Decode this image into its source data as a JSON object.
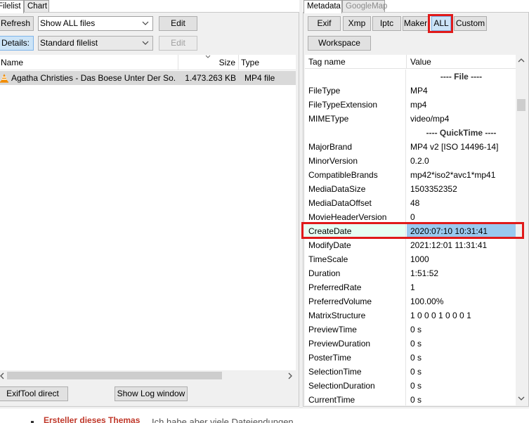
{
  "left_tabs": [
    "Filelist",
    "Chart"
  ],
  "right_tabs": [
    "Metadata",
    "GoogleMap"
  ],
  "left_toolbar": {
    "refresh_label": "Refresh",
    "filter_value": "Show ALL files",
    "edit_label": "Edit",
    "details_label": "Details:",
    "view_value": "Standard filelist",
    "edit2_label": "Edit"
  },
  "filelist": {
    "columns": [
      "Name",
      "Size",
      "Type"
    ],
    "rows": [
      {
        "name": "Agatha Christies - Das Boese Unter Der So...",
        "size": "1.473.263 KB",
        "type": "MP4 file"
      }
    ]
  },
  "bottom_left": {
    "exiftool_direct": "ExifTool direct",
    "show_log": "Show Log window"
  },
  "meta_buttons": [
    "Exif",
    "Xmp",
    "Iptc",
    "Maker",
    "ALL",
    "Custom"
  ],
  "workspace_label": "Workspace",
  "meta_table": {
    "headers": [
      "Tag name",
      "Value"
    ],
    "rows": [
      {
        "tag": "",
        "value": "---- File ----",
        "group": true
      },
      {
        "tag": "FileType",
        "value": "MP4"
      },
      {
        "tag": "FileTypeExtension",
        "value": "mp4"
      },
      {
        "tag": "MIMEType",
        "value": "video/mp4"
      },
      {
        "tag": "",
        "value": "---- QuickTime ----",
        "group": true
      },
      {
        "tag": "MajorBrand",
        "value": "MP4 v2 [ISO 14496-14]"
      },
      {
        "tag": "MinorVersion",
        "value": "0.2.0"
      },
      {
        "tag": "CompatibleBrands",
        "value": "mp42*iso2*avc1*mp41"
      },
      {
        "tag": "MediaDataSize",
        "value": "1503352352"
      },
      {
        "tag": "MediaDataOffset",
        "value": "48"
      },
      {
        "tag": "MovieHeaderVersion",
        "value": "0"
      },
      {
        "tag": "CreateDate",
        "value": "2020:07:10 10:31:41",
        "selected": true
      },
      {
        "tag": "ModifyDate",
        "value": "2021:12:01 11:31:41"
      },
      {
        "tag": "TimeScale",
        "value": "1000"
      },
      {
        "tag": "Duration",
        "value": "1:51:52"
      },
      {
        "tag": "PreferredRate",
        "value": "1"
      },
      {
        "tag": "PreferredVolume",
        "value": "100.00%"
      },
      {
        "tag": "MatrixStructure",
        "value": "1 0 0 0 1 0 0 0 1"
      },
      {
        "tag": "PreviewTime",
        "value": "0 s"
      },
      {
        "tag": "PreviewDuration",
        "value": "0 s"
      },
      {
        "tag": "PosterTime",
        "value": "0 s"
      },
      {
        "tag": "SelectionTime",
        "value": "0 s"
      },
      {
        "tag": "SelectionDuration",
        "value": "0 s"
      },
      {
        "tag": "CurrentTime",
        "value": "0 s"
      }
    ]
  },
  "background_text": [
    "Ersteller dieses Themas",
    "Ich habe aber viele Dateiendungen"
  ],
  "colors": {
    "selection": "#99c9ef",
    "selected_tag_bg": "#e6fff3",
    "highlight_box": "#e01a1a",
    "pressed_button": "#cce4f7",
    "file_row_bg": "#d9d9d9"
  },
  "icons": {
    "vlc": "vlc-cone-icon",
    "chevron": "chevron-down-icon"
  }
}
